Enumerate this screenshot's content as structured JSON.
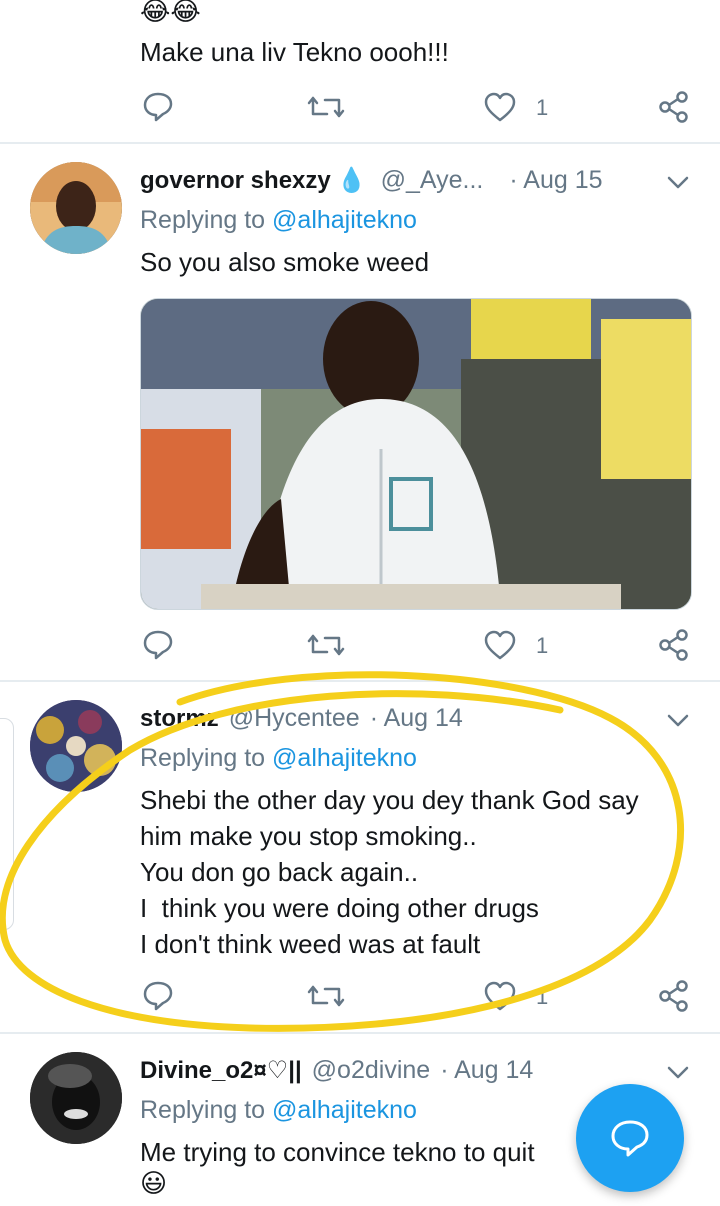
{
  "tweets": [
    {
      "emoji_line": "😂😂",
      "text_lines": [
        "Make una liv Tekno oooh!!!"
      ],
      "actions": {
        "like_count": "1"
      }
    },
    {
      "display_name": "governor shexzy",
      "verified_drop": "💧",
      "handle": "@_Aye...",
      "date": "· Aug 15",
      "replying_label": "Replying to",
      "replying_to": "@alhajitekno",
      "text_lines": [
        "So you also smoke weed"
      ],
      "actions": {
        "like_count": "1"
      }
    },
    {
      "display_name": "stormz",
      "handle": "@Hycentee",
      "date": "· Aug 14",
      "replying_label": "Replying to",
      "replying_to": "@alhajitekno",
      "text_lines": [
        "Shebi the other day you dey thank God say",
        "him make you stop smoking..",
        "You don go back again..",
        "I  think you were doing other drugs",
        "I don't think weed was at fault"
      ],
      "actions": {
        "like_count": "1"
      }
    },
    {
      "display_name": "Divine_o2¤♡||",
      "handle": "@o2divine",
      "date": "· Aug 14",
      "replying_label": "Replying to",
      "replying_to": "@alhajitekno",
      "text_lines": [
        "Me trying to convince tekno to quit"
      ],
      "emoji_line": "😃"
    }
  ],
  "icons": {
    "reply": "reply-icon",
    "retweet": "retweet-icon",
    "like": "heart-icon",
    "share": "share-icon",
    "compose": "compose-reply-icon",
    "chevron": "chevron-down-icon"
  },
  "colors": {
    "accent": "#1da1f2",
    "mention": "#1b95e0",
    "muted": "#657786",
    "highlight_circle": "#f5cf1b"
  }
}
